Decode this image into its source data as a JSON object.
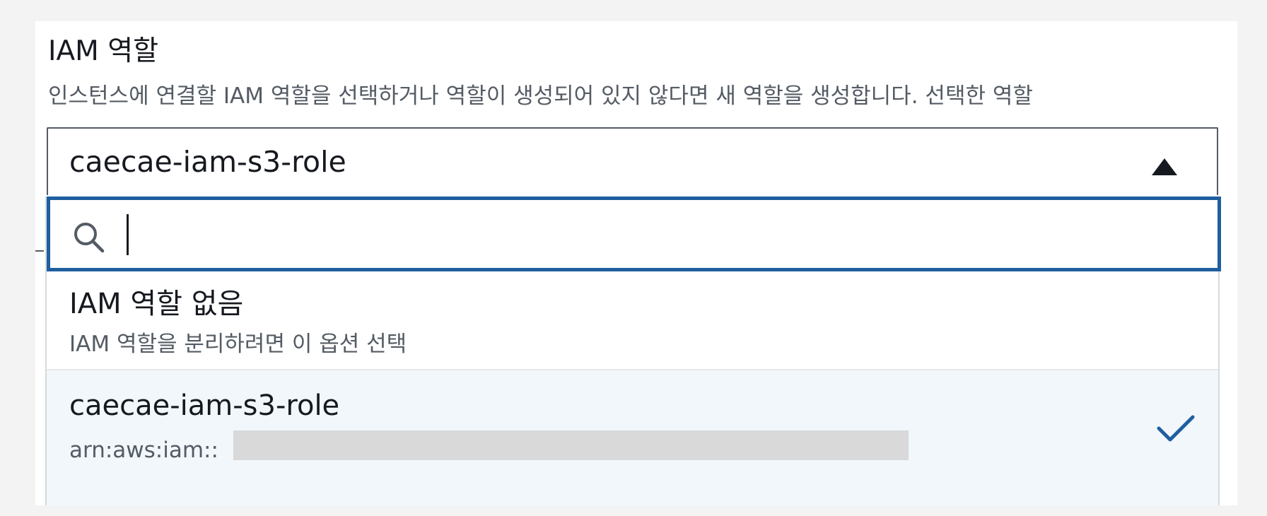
{
  "field": {
    "label": "IAM 역할",
    "description": "인스턴스에 연결할 IAM 역할을 선택하거나 역할이 생성되어 있지 않다면 새 역할을 생성합니다. 선택한 역할"
  },
  "select": {
    "selected_value": "caecae-iam-s3-role",
    "expanded": true
  },
  "search": {
    "value": "",
    "placeholder": ""
  },
  "options": [
    {
      "title": "IAM 역할 없음",
      "description": "IAM 역할을 분리하려면 이 옵션 선택",
      "selected": false
    },
    {
      "title": "caecae-iam-s3-role",
      "description": "arn:aws:iam::",
      "selected": true
    }
  ],
  "icons": {
    "caret": "caret-up-icon",
    "search": "search-icon",
    "check": "check-icon"
  },
  "colors": {
    "focus_border": "#1f5f9f",
    "selected_option_bg": "#f1f7fb",
    "check": "#1f5f9f"
  }
}
